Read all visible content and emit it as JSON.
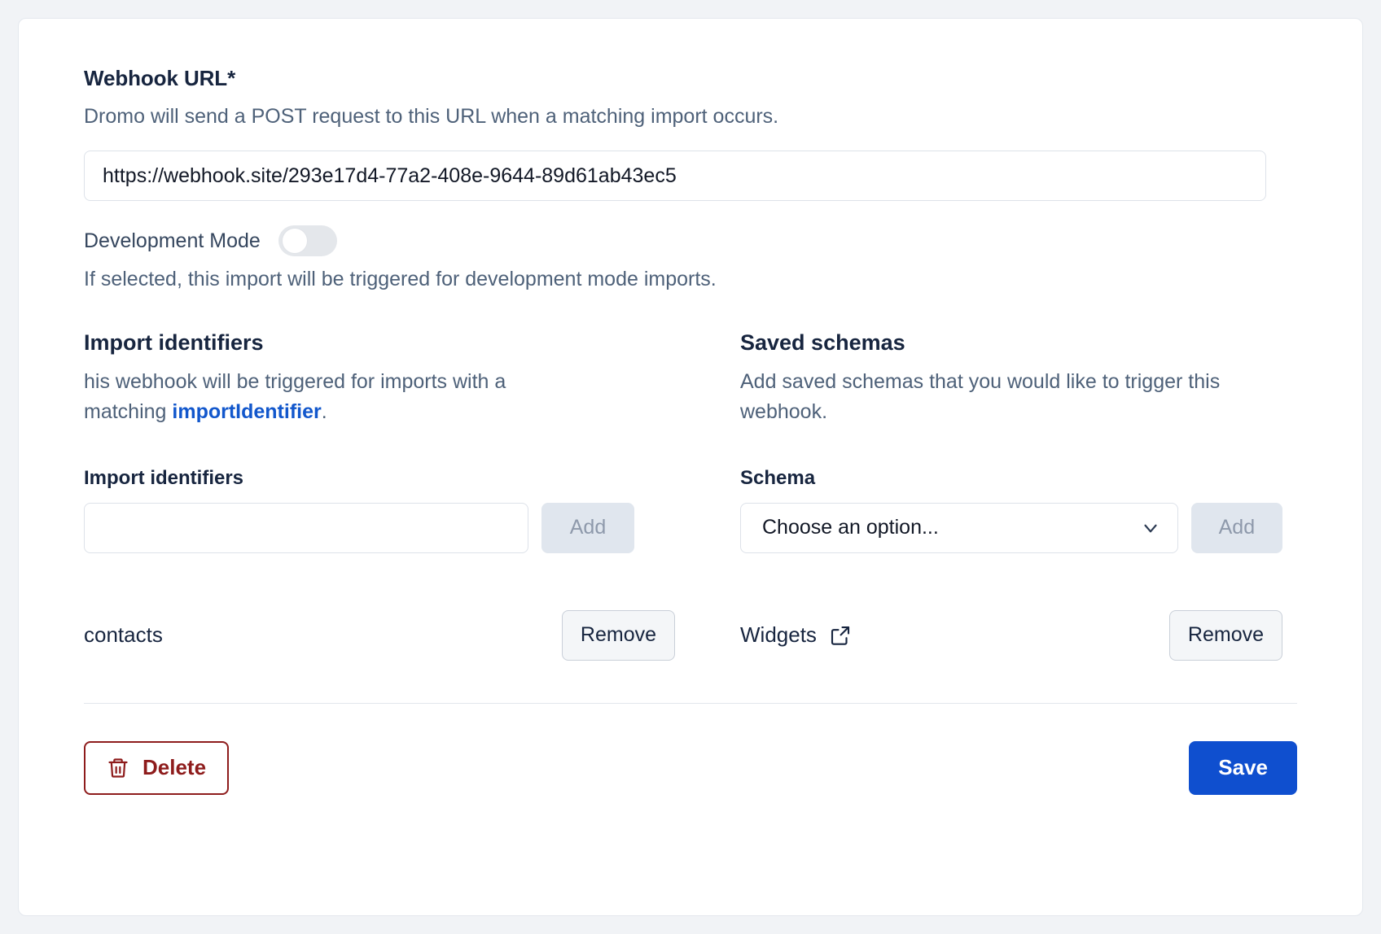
{
  "webhook": {
    "heading": "Webhook URL*",
    "description": "Dromo will send a POST request to this URL when a matching import occurs.",
    "url_value": "https://webhook.site/293e17d4-77a2-408e-9644-89d61ab43ec5",
    "url_placeholder": "https://"
  },
  "development_mode": {
    "label": "Development Mode",
    "enabled": false,
    "help": "If selected, this import will be triggered for development mode imports."
  },
  "import_identifiers": {
    "heading": "Import identifiers",
    "description_prefix": "his webhook will be triggered for imports with a matching ",
    "description_link": "importIdentifier",
    "description_suffix": ".",
    "field_label": "Import identifiers",
    "input_value": "",
    "input_placeholder": "",
    "add_label": "Add",
    "add_disabled": true,
    "items": [
      {
        "name": "contacts",
        "remove_label": "Remove"
      }
    ]
  },
  "saved_schemas": {
    "heading": "Saved schemas",
    "description": "Add saved schemas that you would like to trigger this webhook.",
    "field_label": "Schema",
    "select_value": "Choose an option...",
    "add_label": "Add",
    "add_disabled": true,
    "items": [
      {
        "name": "Widgets",
        "remove_label": "Remove",
        "link_icon": "external-link-icon"
      }
    ]
  },
  "footer": {
    "delete_label": "Delete",
    "delete_icon": "trash-icon",
    "save_label": "Save"
  },
  "colors": {
    "accent_blue": "#0f4fcf",
    "link_blue": "#1257cc",
    "danger_red": "#8e1c1c",
    "heading_navy": "#17253f",
    "muted_slate": "#4e6179",
    "disabled_bg": "#e0e6ee",
    "disabled_text": "#8e99ab"
  }
}
